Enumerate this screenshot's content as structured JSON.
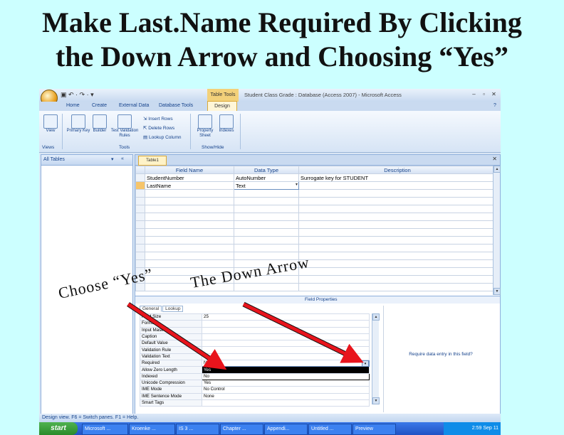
{
  "slide": {
    "title_line1": "Make Last.Name Required By Clicking",
    "title_line2": "the Down Arrow and Choosing “Yes”",
    "callout_choose": "Choose “Yes”",
    "callout_arrow": "The Down Arrow"
  },
  "window": {
    "context_tab": "Table Tools",
    "title": "Student Class Grade : Database (Access 2007) - Microsoft Access",
    "help_icon": "help-icon"
  },
  "ribbon": {
    "tabs": [
      "Home",
      "Create",
      "External Data",
      "Database Tools"
    ],
    "active_tab": "Design",
    "buttons": {
      "view": "View",
      "primary_key": "Primary Key",
      "builder": "Builder",
      "test_validation": "Test Validation Rules",
      "insert_rows": "Insert Rows",
      "delete_rows": "Delete Rows",
      "lookup_column": "Lookup Column",
      "property_sheet": "Property Sheet",
      "indexes": "Indexes"
    },
    "groups": {
      "views": "Views",
      "tools": "Tools",
      "show_hide": "Show/Hide"
    }
  },
  "nav_pane": {
    "header": "All Tables"
  },
  "document": {
    "tab": "Table1",
    "grid_headers": [
      "Field Name",
      "Data Type",
      "Description"
    ],
    "rows": [
      {
        "field": "StudentNumber",
        "type": "AutoNumber",
        "desc": "Surrogate key for STUDENT"
      },
      {
        "field": "LastName",
        "type": "Text",
        "desc": ""
      }
    ]
  },
  "field_properties": {
    "header": "Field Properties",
    "tabs": [
      "General",
      "Lookup"
    ],
    "rows": [
      {
        "label": "Field Size",
        "value": "25"
      },
      {
        "label": "Format",
        "value": ""
      },
      {
        "label": "Input Mask",
        "value": ""
      },
      {
        "label": "Caption",
        "value": ""
      },
      {
        "label": "Default Value",
        "value": ""
      },
      {
        "label": "Validation Rule",
        "value": ""
      },
      {
        "label": "Validation Text",
        "value": ""
      },
      {
        "label": "Required",
        "value": "No"
      },
      {
        "label": "Allow Zero Length",
        "value": "Yes"
      },
      {
        "label": "Indexed",
        "value": "No"
      },
      {
        "label": "Unicode Compression",
        "value": "Yes"
      },
      {
        "label": "IME Mode",
        "value": "No Control"
      },
      {
        "label": "IME Sentence Mode",
        "value": "None"
      },
      {
        "label": "Smart Tags",
        "value": ""
      }
    ],
    "help_text": "Require data entry in this field?"
  },
  "statusbar": {
    "text": "Design view. F6 = Switch panes. F1 = Help."
  },
  "taskbar": {
    "start": "start",
    "items": [
      "Microsoft ...",
      "Kroenke ...",
      "IS 3 ...",
      "Chapter ...",
      "Appendi...",
      "Untitled ...",
      "Preview"
    ],
    "clock": "2:59 Sep 11"
  },
  "colors": {
    "slide_background": "#ccffff",
    "arrow": "#e8141c",
    "ribbon_blue": "#15428b"
  }
}
